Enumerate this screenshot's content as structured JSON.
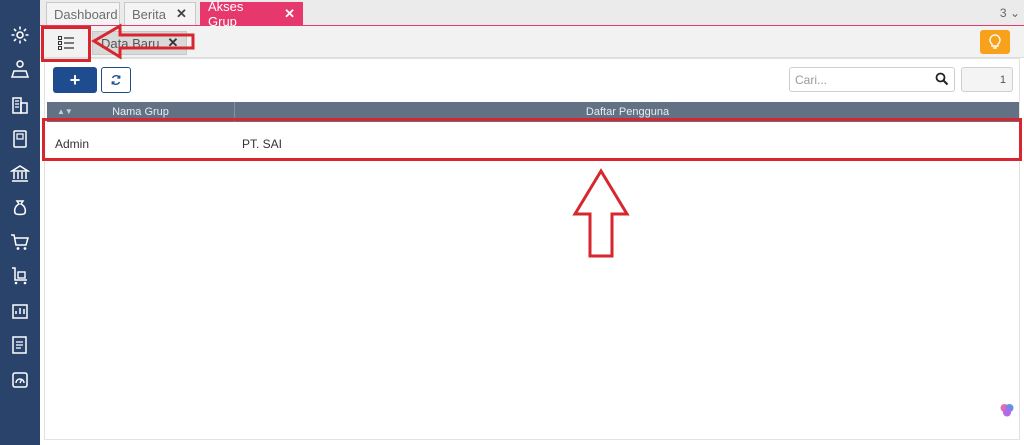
{
  "tabs": [
    {
      "label": "Dashboard",
      "closable": false,
      "active": false
    },
    {
      "label": "Berita",
      "closable": true,
      "active": false
    },
    {
      "label": "Akses Grup",
      "closable": true,
      "active": true
    }
  ],
  "tab_count": "3",
  "subtabs": {
    "data_baru_label": "Data Baru",
    "close_symbol": "✕"
  },
  "toolbar": {
    "add_symbol": "+",
    "search_placeholder": "Cari...",
    "page_number": "1"
  },
  "grid": {
    "columns": [
      "Nama Grup",
      "Daftar Pengguna"
    ],
    "rows": [
      {
        "nama_grup": "Admin",
        "daftar_pengguna": "PT. SAI"
      }
    ]
  },
  "sidebar_icons": [
    "gear-icon",
    "user-desk-icon",
    "building-icon",
    "book-icon",
    "bank-icon",
    "money-bag-icon",
    "cart-icon",
    "cart-box-icon",
    "report-icon",
    "tax-doc-icon",
    "gauge-icon"
  ],
  "colors": {
    "sidebar": "#29436b",
    "active_tab": "#e6386d",
    "primary_button": "#1f4c8f",
    "bulb_button": "#f7a21a",
    "grid_header": "#627284",
    "annotation": "#d7262d"
  }
}
